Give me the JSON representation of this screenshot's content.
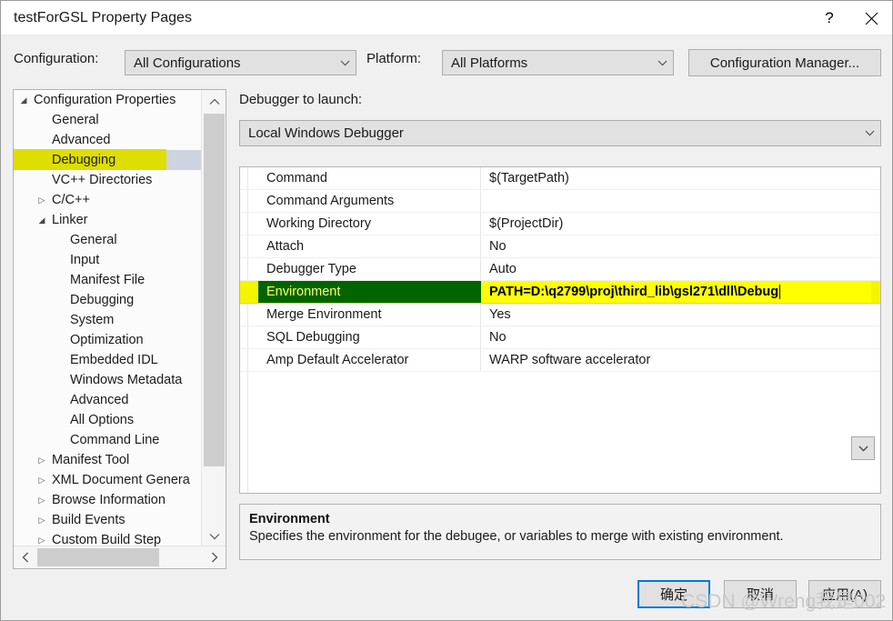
{
  "window": {
    "title": "testForGSL Property Pages",
    "help_icon": "question-mark-icon",
    "close_icon": "close-x-icon"
  },
  "config_bar": {
    "configuration_label": "Configuration:",
    "configuration_value": "All Configurations",
    "platform_label": "Platform:",
    "platform_value": "All Platforms",
    "config_manager_button": "Configuration Manager..."
  },
  "tree": {
    "items": [
      {
        "label": "Configuration Properties",
        "indent": 0,
        "arrow": "◢",
        "expanded": true,
        "selected": false,
        "highlighted": false
      },
      {
        "label": "General",
        "indent": 1,
        "arrow": "",
        "expanded": false,
        "selected": false,
        "highlighted": false
      },
      {
        "label": "Advanced",
        "indent": 1,
        "arrow": "",
        "expanded": false,
        "selected": false,
        "highlighted": false
      },
      {
        "label": "Debugging",
        "indent": 1,
        "arrow": "",
        "expanded": false,
        "selected": true,
        "highlighted": true
      },
      {
        "label": "VC++ Directories",
        "indent": 1,
        "arrow": "",
        "expanded": false,
        "selected": false,
        "highlighted": false
      },
      {
        "label": "C/C++",
        "indent": 1,
        "arrow": "▷",
        "expanded": false,
        "selected": false,
        "highlighted": false
      },
      {
        "label": "Linker",
        "indent": 1,
        "arrow": "◢",
        "expanded": true,
        "selected": false,
        "highlighted": false
      },
      {
        "label": "General",
        "indent": 2,
        "arrow": "",
        "expanded": false,
        "selected": false,
        "highlighted": false
      },
      {
        "label": "Input",
        "indent": 2,
        "arrow": "",
        "expanded": false,
        "selected": false,
        "highlighted": false
      },
      {
        "label": "Manifest File",
        "indent": 2,
        "arrow": "",
        "expanded": false,
        "selected": false,
        "highlighted": false
      },
      {
        "label": "Debugging",
        "indent": 2,
        "arrow": "",
        "expanded": false,
        "selected": false,
        "highlighted": false
      },
      {
        "label": "System",
        "indent": 2,
        "arrow": "",
        "expanded": false,
        "selected": false,
        "highlighted": false
      },
      {
        "label": "Optimization",
        "indent": 2,
        "arrow": "",
        "expanded": false,
        "selected": false,
        "highlighted": false
      },
      {
        "label": "Embedded IDL",
        "indent": 2,
        "arrow": "",
        "expanded": false,
        "selected": false,
        "highlighted": false
      },
      {
        "label": "Windows Metadata",
        "indent": 2,
        "arrow": "",
        "expanded": false,
        "selected": false,
        "highlighted": false
      },
      {
        "label": "Advanced",
        "indent": 2,
        "arrow": "",
        "expanded": false,
        "selected": false,
        "highlighted": false
      },
      {
        "label": "All Options",
        "indent": 2,
        "arrow": "",
        "expanded": false,
        "selected": false,
        "highlighted": false
      },
      {
        "label": "Command Line",
        "indent": 2,
        "arrow": "",
        "expanded": false,
        "selected": false,
        "highlighted": false
      },
      {
        "label": "Manifest Tool",
        "indent": 1,
        "arrow": "▷",
        "expanded": false,
        "selected": false,
        "highlighted": false
      },
      {
        "label": "XML Document Genera",
        "indent": 1,
        "arrow": "▷",
        "expanded": false,
        "selected": false,
        "highlighted": false
      },
      {
        "label": "Browse Information",
        "indent": 1,
        "arrow": "▷",
        "expanded": false,
        "selected": false,
        "highlighted": false
      },
      {
        "label": "Build Events",
        "indent": 1,
        "arrow": "▷",
        "expanded": false,
        "selected": false,
        "highlighted": false
      },
      {
        "label": "Custom Build Step",
        "indent": 1,
        "arrow": "▷",
        "expanded": false,
        "selected": false,
        "highlighted": false
      }
    ],
    "vscroll_up_icon": "chevron-up-icon",
    "vscroll_down_icon": "chevron-down-icon",
    "hscroll_left_icon": "chevron-left-icon",
    "hscroll_right_icon": "chevron-right-icon"
  },
  "right_pane": {
    "debugger_label": "Debugger to launch:",
    "debugger_value": "Local Windows Debugger",
    "grid_rows": [
      {
        "name": "Command",
        "value": "$(TargetPath)",
        "highlighted": false
      },
      {
        "name": "Command Arguments",
        "value": "",
        "highlighted": false
      },
      {
        "name": "Working Directory",
        "value": "$(ProjectDir)",
        "highlighted": false
      },
      {
        "name": "Attach",
        "value": "No",
        "highlighted": false
      },
      {
        "name": "Debugger Type",
        "value": "Auto",
        "highlighted": false
      },
      {
        "name": "Environment",
        "value": "PATH=D:\\q2799\\proj\\third_lib\\gsl271\\dll\\Debug",
        "highlighted": true
      },
      {
        "name": "Merge Environment",
        "value": "Yes",
        "highlighted": false
      },
      {
        "name": "SQL Debugging",
        "value": "No",
        "highlighted": false
      },
      {
        "name": "Amp Default Accelerator",
        "value": "WARP software accelerator",
        "highlighted": false
      }
    ],
    "value_dropdown_icon": "chevron-down-icon",
    "description_title": "Environment",
    "description_body": "Specifies the environment for the debugee, or variables to merge with existing environment."
  },
  "footer": {
    "ok_button": "确定",
    "cancel_button": "取消",
    "apply_button": "应用(A)"
  },
  "watermark": "CSDN @Wreng我是002",
  "colors": {
    "dialog_bg": "#f0f0f0",
    "highlight_yellow": "#f5f500",
    "value_yellow": "#ffff00",
    "env_green": "#006400",
    "env_green_text": "#ffff66",
    "selection_blue": "#cdd3e0",
    "focus_blue": "#0078d7"
  }
}
